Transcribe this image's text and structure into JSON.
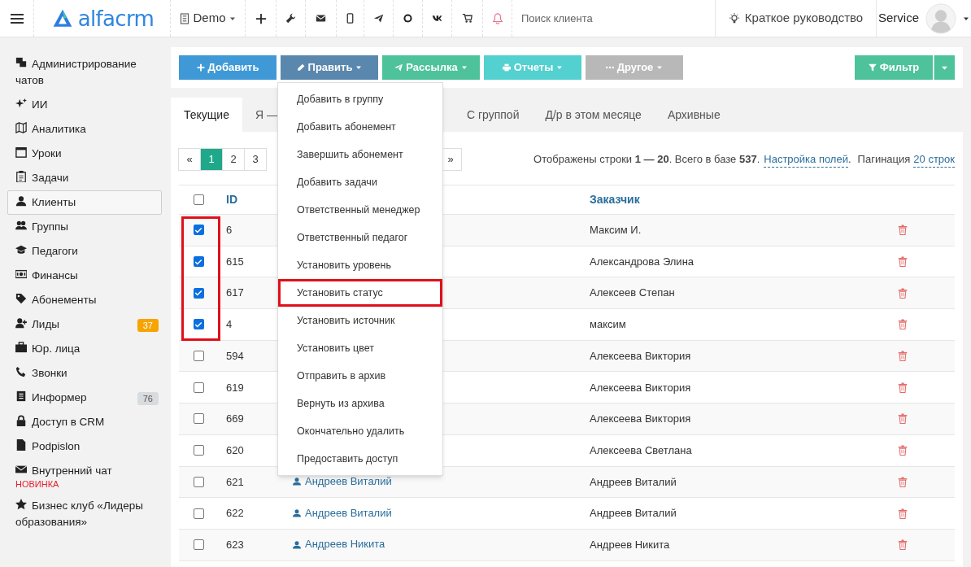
{
  "header": {
    "logo": "alfacrm",
    "branch": "Demo",
    "search": {
      "placeholder": "Поиск клиента"
    },
    "guide": "Краткое руководство",
    "user": "Service"
  },
  "sidebar": {
    "items": [
      {
        "label": "Администрирование чатов",
        "selected": false
      },
      {
        "label": "ИИ",
        "selected": false
      },
      {
        "label": "Аналитика",
        "selected": false
      },
      {
        "label": "Уроки",
        "selected": false
      },
      {
        "label": "Задачи",
        "selected": false
      },
      {
        "label": "Клиенты",
        "selected": true
      },
      {
        "label": "Группы",
        "selected": false
      },
      {
        "label": "Педагоги",
        "selected": false
      },
      {
        "label": "Финансы",
        "selected": false
      },
      {
        "label": "Абонементы",
        "selected": false
      },
      {
        "label": "Лиды",
        "selected": false,
        "badge": {
          "text": "37",
          "color": "#f7a400"
        }
      },
      {
        "label": "Юр. лица",
        "selected": false
      },
      {
        "label": "Звонки",
        "selected": false
      },
      {
        "label": "Информер",
        "selected": false,
        "badge": {
          "text": "76",
          "color": "#d9dcde"
        }
      },
      {
        "label": "Доступ в CRM",
        "selected": false
      },
      {
        "label": "Podpislon",
        "selected": false
      },
      {
        "label": "Внутренний чат",
        "selected": false,
        "note": "НОВИНКА"
      },
      {
        "label": "Бизнес клуб «Лидеры образования»",
        "selected": false
      }
    ]
  },
  "toolbar": {
    "buttons": [
      {
        "label": "Добавить",
        "color": "#3f99d6",
        "caret": false
      },
      {
        "label": "Править",
        "color": "#5a87ad",
        "caret": true
      },
      {
        "label": "Рассылка",
        "color": "#4ec29b",
        "caret": true
      },
      {
        "label": "Отчеты",
        "color": "#53d0d0",
        "caret": true
      },
      {
        "label": "Другое",
        "color": "#b8b8b8",
        "caret": true
      }
    ],
    "filter": {
      "label": "Фильтр",
      "color": "#4ec29b"
    }
  },
  "tabs": [
    {
      "label": "Текущие",
      "selected": true
    },
    {
      "label": "Я —",
      "selected": false
    },
    {
      "label": "С группой",
      "selected": false
    },
    {
      "label": "Д/р в этом месяце",
      "selected": false
    },
    {
      "label": "Архивные",
      "selected": false
    }
  ],
  "pagination": {
    "pages": [
      {
        "label": "«",
        "selected": false
      },
      {
        "label": "1",
        "selected": true
      },
      {
        "label": "2",
        "selected": false
      },
      {
        "label": "3",
        "selected": false
      },
      {
        "label": "»",
        "selected": false
      }
    ],
    "info": "Отображены строки **1 — 20**. Всего в базе **537**.",
    "fields_link": "Настройка полей",
    "separator": ".",
    "pagination_label": "Пагинация",
    "rows_link": "20 строк"
  },
  "table": {
    "columns": [
      "ID",
      "Заказчик"
    ],
    "select_all_checked": false,
    "rows": [
      {
        "checked": true,
        "id": "6",
        "customer": "Максим И."
      },
      {
        "checked": true,
        "id": "615",
        "customer": "Александрова Элина"
      },
      {
        "checked": true,
        "id": "617",
        "customer": "Алексеев Степан"
      },
      {
        "checked": true,
        "id": "4",
        "customer": "максим"
      },
      {
        "checked": false,
        "id": "594",
        "customer": "Алексеева Виктория"
      },
      {
        "checked": false,
        "id": "619",
        "customer": "Алексеева Виктория"
      },
      {
        "checked": false,
        "id": "669",
        "customer": "Алексеева Виктория"
      },
      {
        "checked": false,
        "id": "620",
        "customer": "Алексеева Светлана"
      },
      {
        "checked": false,
        "id": "621",
        "name": "Андреев Виталий",
        "customer": "Андреев Виталий"
      },
      {
        "checked": false,
        "id": "622",
        "name": "Андреев Виталий",
        "customer": "Андреев Виталий"
      },
      {
        "checked": false,
        "id": "623",
        "name": "Андреев Никита",
        "customer": "Андреев Никита"
      }
    ]
  },
  "edit_menu": {
    "items": [
      {
        "label": "Добавить в группу",
        "highlighted": false
      },
      {
        "label": "Добавить абонемент",
        "highlighted": false
      },
      {
        "label": "Завершить абонемент",
        "highlighted": false
      },
      {
        "label": "Добавить задачи",
        "highlighted": false
      },
      {
        "label": "Ответственный менеджер",
        "highlighted": false
      },
      {
        "label": "Ответственный педагог",
        "highlighted": false
      },
      {
        "label": "Установить уровень",
        "highlighted": false
      },
      {
        "label": "Установить статус",
        "highlighted": true
      },
      {
        "label": "Установить источник",
        "highlighted": false
      },
      {
        "label": "Установить цвет",
        "highlighted": false
      },
      {
        "label": "Отправить в архив",
        "highlighted": false
      },
      {
        "label": "Вернуть из архива",
        "highlighted": false
      },
      {
        "label": "Окончательно удалить",
        "highlighted": false
      },
      {
        "label": "Предоставить доступ",
        "highlighted": false
      }
    ]
  }
}
